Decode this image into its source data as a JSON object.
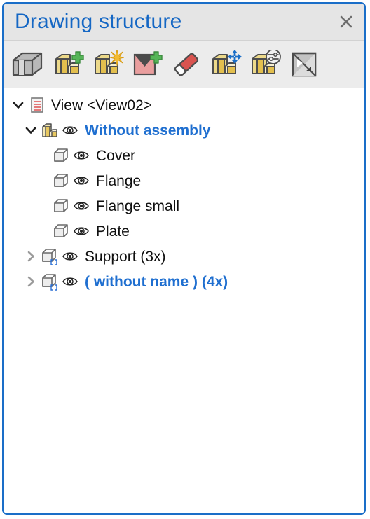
{
  "window": {
    "title": "Drawing structure",
    "close_label": "×",
    "border_color": "#1a6ec8",
    "title_color": "#1567c4",
    "titlebar_bg": "#e5e5e5",
    "toolbar_bg": "#ececec"
  },
  "toolbar": {
    "buttons": [
      {
        "name": "show-all-parts-icon",
        "tooltip": "Show all parts"
      },
      {
        "name": "add-assembly-icon",
        "tooltip": "Add assembly"
      },
      {
        "name": "new-assembly-icon",
        "tooltip": "New assembly"
      },
      {
        "name": "add-view-icon",
        "tooltip": "Add view"
      },
      {
        "name": "eraser-icon",
        "tooltip": "Erase"
      },
      {
        "name": "move-assembly-icon",
        "tooltip": "Move assembly"
      },
      {
        "name": "assembly-properties-icon",
        "tooltip": "Assembly properties"
      },
      {
        "name": "contrast-icon",
        "tooltip": "Display style"
      }
    ]
  },
  "tree": {
    "items": [
      {
        "label": "View <View02>",
        "icon": "view-document-icon",
        "twisty": "expanded",
        "indent": 0,
        "has_eye": false,
        "accent": false
      },
      {
        "label": "Without assembly",
        "icon": "assembly-icon",
        "twisty": "expanded",
        "indent": 1,
        "has_eye": true,
        "accent": true
      },
      {
        "label": "Cover",
        "icon": "part-cube-icon",
        "twisty": "none",
        "indent": 2,
        "has_eye": true,
        "accent": false
      },
      {
        "label": "Flange",
        "icon": "part-cube-icon",
        "twisty": "none",
        "indent": 2,
        "has_eye": true,
        "accent": false
      },
      {
        "label": "Flange small",
        "icon": "part-cube-icon",
        "twisty": "none",
        "indent": 2,
        "has_eye": true,
        "accent": false
      },
      {
        "label": "Plate",
        "icon": "part-cube-icon",
        "twisty": "none",
        "indent": 2,
        "has_eye": true,
        "accent": false
      },
      {
        "label": "Support (3x)",
        "icon": "part-array-cube-icon",
        "twisty": "collapsed",
        "indent": 1,
        "has_eye": true,
        "accent": false
      },
      {
        "label": "( without name ) (4x)",
        "icon": "part-array-cube-icon",
        "twisty": "collapsed",
        "indent": 1,
        "has_eye": true,
        "accent": true
      }
    ]
  }
}
